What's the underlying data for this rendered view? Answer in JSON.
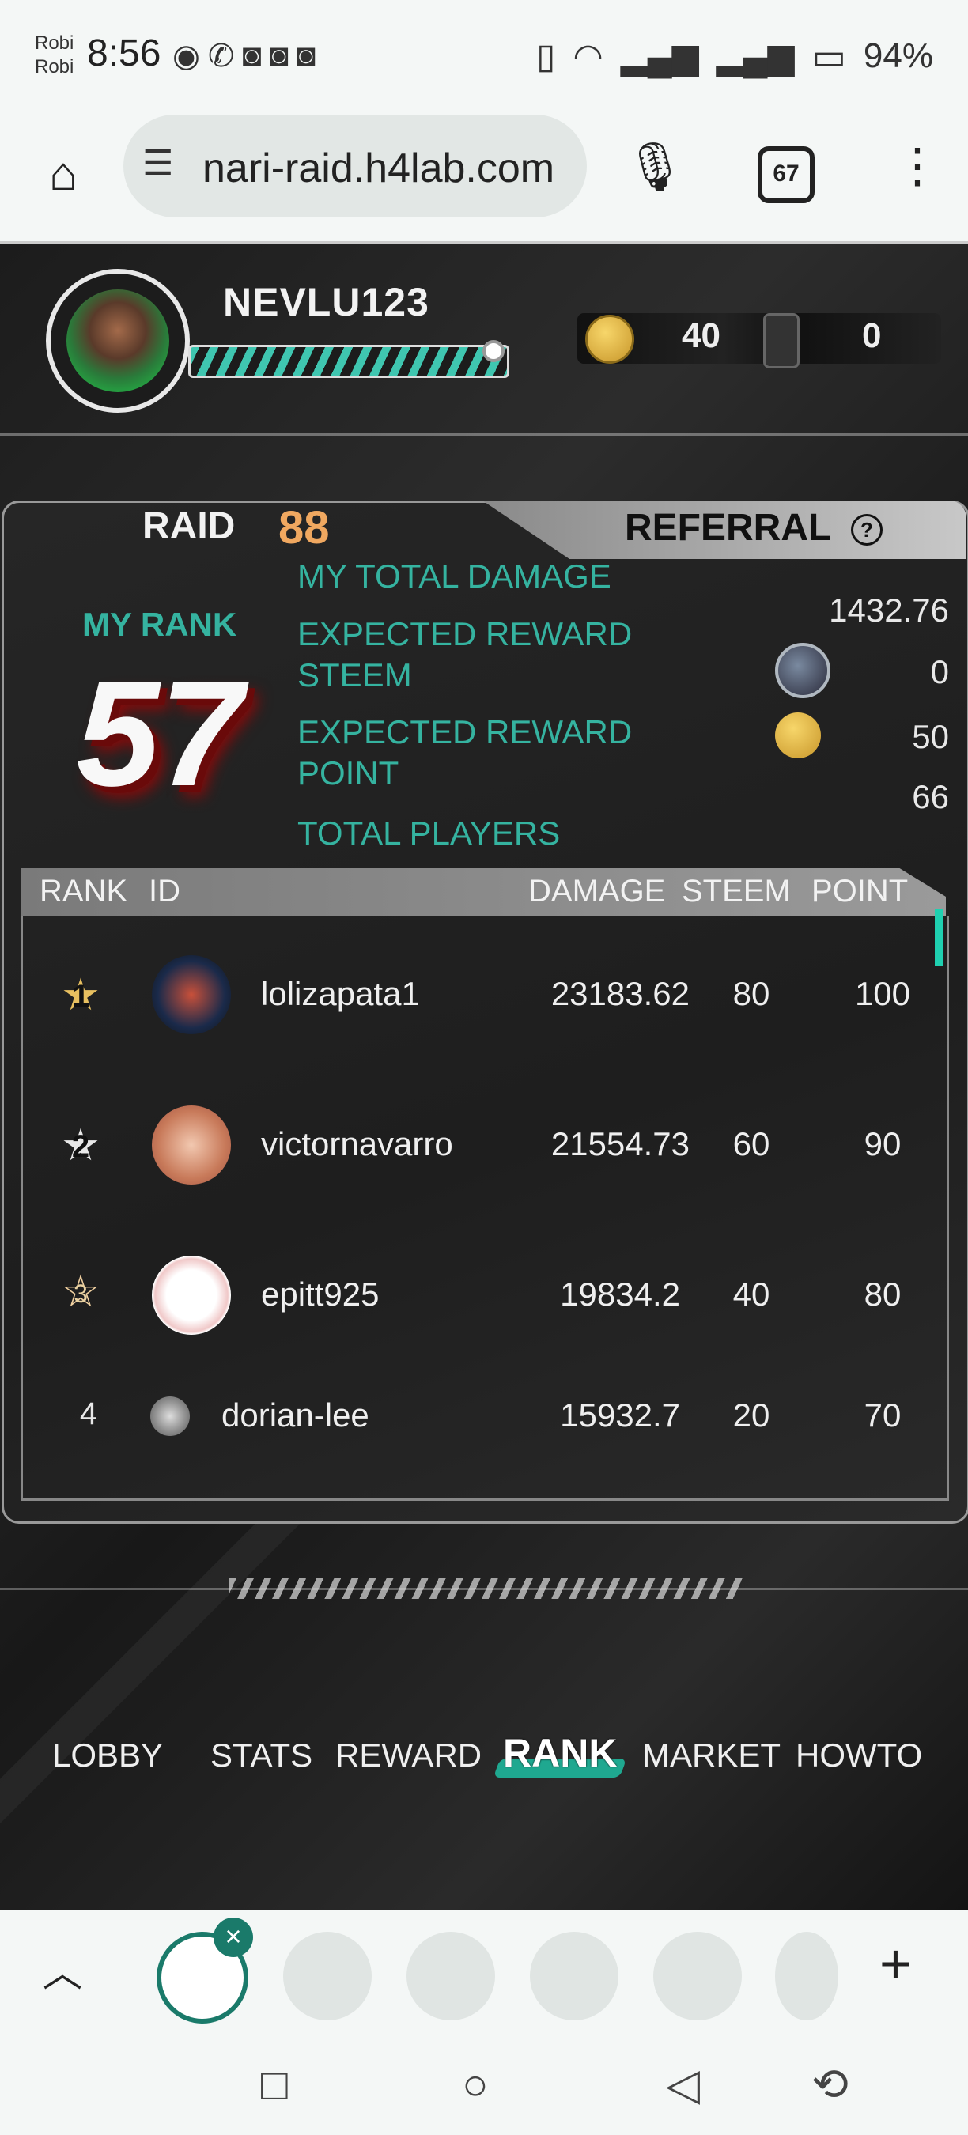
{
  "status_bar": {
    "carrier_line1": "Robi",
    "carrier_line2": "Robi",
    "time": "8:56",
    "battery": "94%"
  },
  "browser": {
    "url": "nari-raid.h4lab.com",
    "tab_count": "67"
  },
  "player": {
    "username": "NEVLU123",
    "coins": "40",
    "wallet": "0"
  },
  "raid": {
    "label": "RAID",
    "number": "88",
    "referral_label": "REFERRAL",
    "help": "?"
  },
  "my_stats": {
    "my_rank_label": "MY RANK",
    "my_rank": "57",
    "total_damage_label": "MY TOTAL DAMAGE",
    "total_damage": "1432.76",
    "reward_steem_label_1": "EXPECTED REWARD",
    "reward_steem_label_2": "STEEM",
    "reward_steem": "0",
    "reward_point_label_1": "EXPECTED REWARD",
    "reward_point_label_2": "POINT",
    "reward_point": "50",
    "total_players_label": "TOTAL PLAYERS",
    "total_players": "66"
  },
  "table": {
    "headers": [
      "RANK",
      "ID",
      "DAMAGE",
      "STEEM",
      "POINT"
    ],
    "rows": [
      {
        "rank": "1",
        "id": "lolizapata1",
        "damage": "23183.62",
        "steem": "80",
        "point": "100"
      },
      {
        "rank": "2",
        "id": "victornavarro",
        "damage": "21554.73",
        "steem": "60",
        "point": "90"
      },
      {
        "rank": "3",
        "id": "epitt925",
        "damage": "19834.2",
        "steem": "40",
        "point": "80"
      },
      {
        "rank": "4",
        "id": "dorian-lee",
        "damage": "15932.7",
        "steem": "20",
        "point": "70"
      }
    ]
  },
  "nav": {
    "lobby": "LOBBY",
    "stats": "STATS",
    "reward": "REWARD",
    "rank": "RANK",
    "market": "MARKET",
    "howto": "HOWTO"
  },
  "colors": {
    "accent_teal": "#35b3a0",
    "raid_orange": "#f0a860",
    "rank_red": "#8a0a0a"
  }
}
